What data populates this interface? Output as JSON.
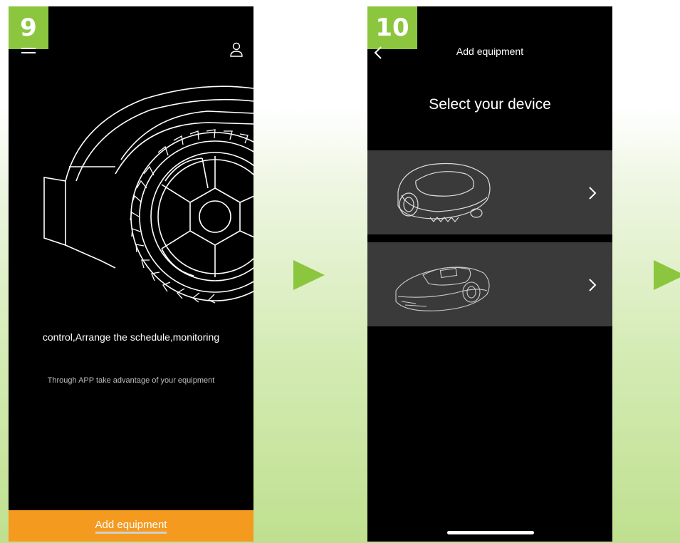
{
  "screen_9": {
    "step": "9",
    "tagline": "control,Arrange the schedule,monitoring",
    "subline": "Through APP take advantage of your equipment",
    "add_button": "Add equipment"
  },
  "screen_10": {
    "step": "10",
    "header_title": "Add equipment",
    "heading": "Select your device"
  },
  "colors": {
    "badge": "#8cc63f",
    "button": "#f39a1f",
    "card": "#3a3a3a",
    "arrow": "#8cc63f"
  },
  "icons": [
    "menu-icon",
    "user-icon",
    "back-icon",
    "chevron-right-icon",
    "play-arrow-icon"
  ]
}
